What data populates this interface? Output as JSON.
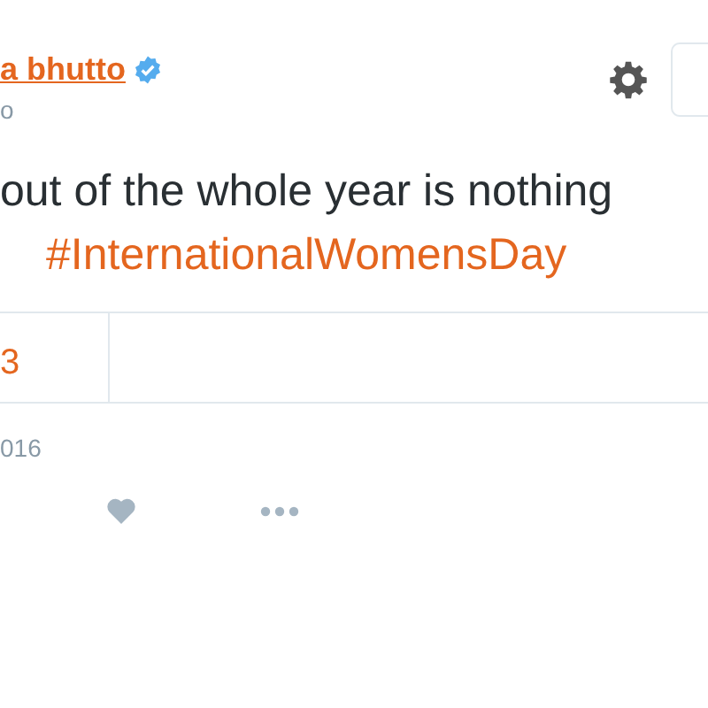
{
  "author": {
    "name": "a bhutto",
    "verified": true,
    "handle": "o"
  },
  "tweet": {
    "text_lines": [
      "out of the whole year is nothing",
      "#InternationalWomensDay"
    ]
  },
  "stats": {
    "value": "3"
  },
  "date": "016",
  "actions": [
    {
      "kind": "like"
    },
    {
      "kind": "more"
    }
  ]
}
